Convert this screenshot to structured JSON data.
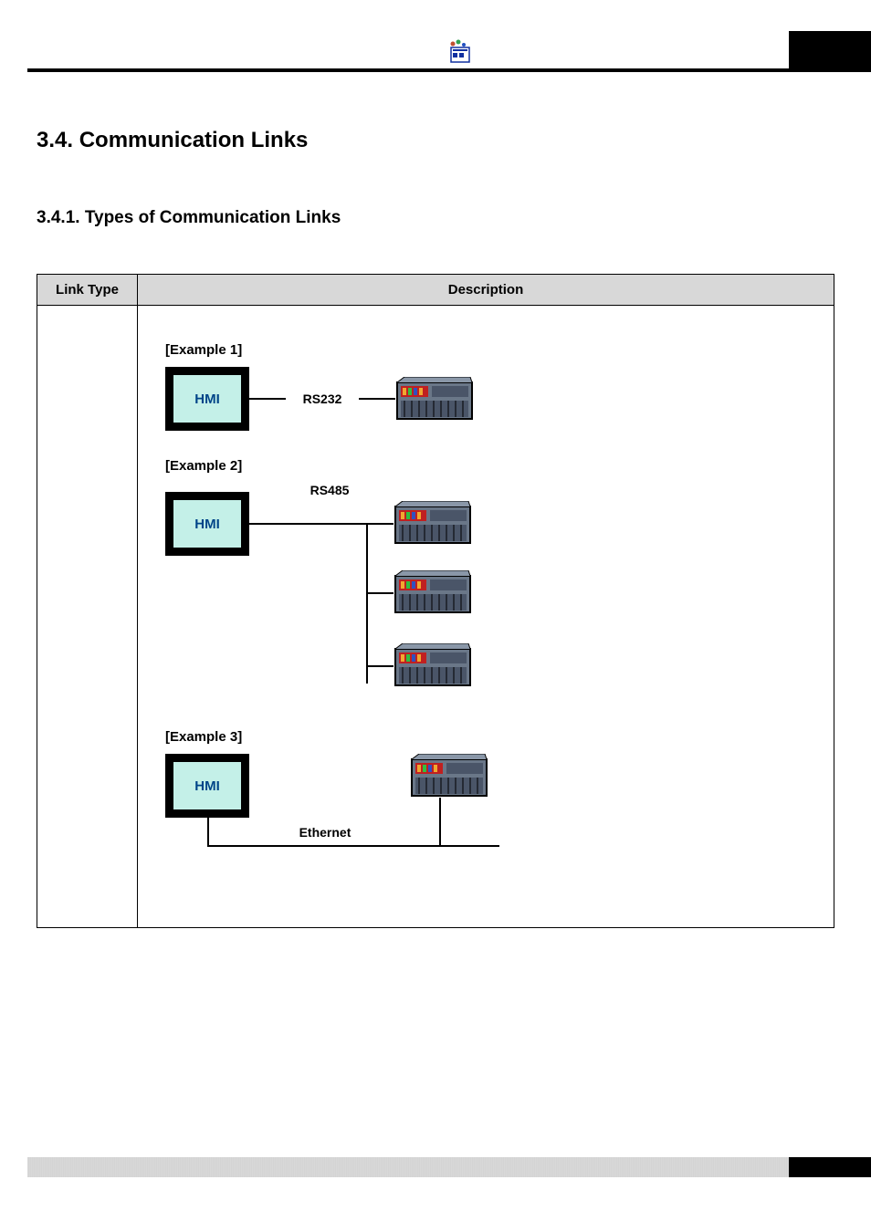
{
  "heading_section": "3.4. Communication Links",
  "heading_subsection": "3.4.1. Types of Communication Links",
  "table": {
    "header_link_type": "Link Type",
    "header_description": "Description"
  },
  "examples": {
    "e1_label": "[Example 1]",
    "e2_label": "[Example 2]",
    "e3_label": "[Example 3]",
    "hmi_text": "HMI",
    "proto_rs232": "RS232",
    "proto_rs485": "RS485",
    "proto_ethernet": "Ethernet"
  }
}
